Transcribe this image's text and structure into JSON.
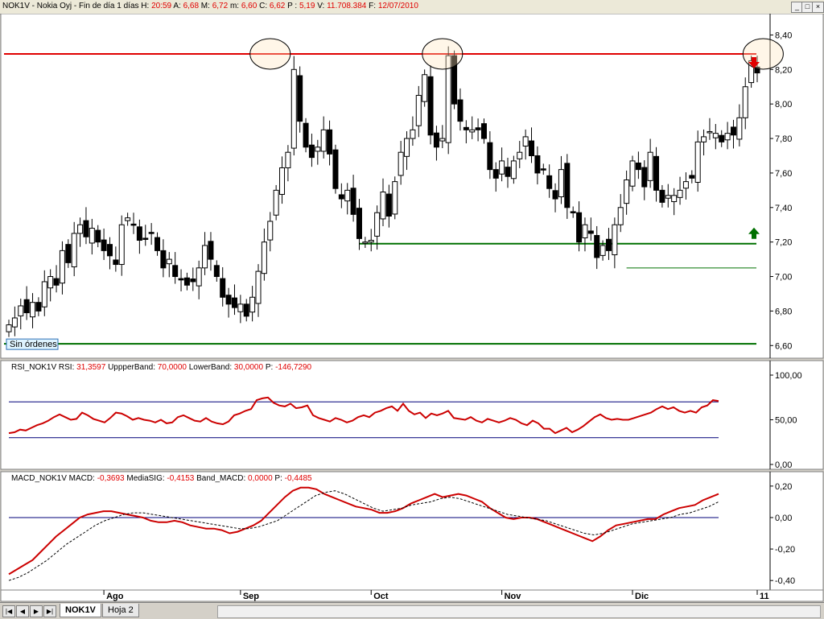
{
  "window": {
    "title": "NOK1V - Nokia Oyj - Fin de día 1 días ",
    "minimize": "_",
    "maximize": "□",
    "close": "×"
  },
  "quote_header": [
    {
      "label": "H: ",
      "value": "20:59"
    },
    {
      "label": "  A: ",
      "value": "6,68"
    },
    {
      "label": "  M: ",
      "value": "6,72"
    },
    {
      "label": "  m: ",
      "value": "6,60"
    },
    {
      "label": "  C: ",
      "value": "6,62"
    },
    {
      "label": "  P : ",
      "value": "5,19"
    },
    {
      "label": "  V: ",
      "value": "11.708.384"
    },
    {
      "label": "  F: ",
      "value": "12/07/2010"
    }
  ],
  "colors": {
    "resistance": "#e00000",
    "support": "#007000",
    "header_value": "#e00000",
    "rsi_line": "#cc0000",
    "macd_line": "#cc0000",
    "band_line": "#00007a",
    "grid_border": "#808080"
  },
  "price_panel": {
    "order_badge": "Sin órdenes",
    "resistance_level": 8.29,
    "support_level": 7.19,
    "support_level_2": 7.05,
    "lower_support_level": 6.61,
    "down_arrow_icon": "arrow-down",
    "up_arrow_icon": "arrow-up"
  },
  "rsi_panel": {
    "header_items": [
      {
        "label": "RSI_NOK1V  RSI: ",
        "value": "31,3597"
      },
      {
        "label": "  UppperBand: ",
        "value": "70,0000"
      },
      {
        "label": "  LowerBand: ",
        "value": "30,0000"
      },
      {
        "label": "  P: ",
        "value": "-146,7290"
      }
    ]
  },
  "macd_panel": {
    "header_items": [
      {
        "label": "MACD_NOK1V  MACD: ",
        "value": "-0,3693"
      },
      {
        "label": "  MediaSIG: ",
        "value": "-0,4153"
      },
      {
        "label": "  Band_MACD: ",
        "value": "0,0000"
      },
      {
        "label": "  P: ",
        "value": "-0,4485"
      }
    ]
  },
  "chart_data": [
    {
      "type": "candlestick",
      "name": "NOK1V",
      "ylim": [
        6.55,
        8.5
      ],
      "y_ticks": [
        "8,40",
        "8,20",
        "8,00",
        "7,80",
        "7,60",
        "7,40",
        "7,20",
        "7,00",
        "6,80",
        "6,60"
      ],
      "y_tick_values": [
        8.4,
        8.2,
        8.0,
        7.8,
        7.6,
        7.4,
        7.2,
        7.0,
        6.8,
        6.6
      ],
      "x_labels": [
        {
          "label": "Ago",
          "index": 16
        },
        {
          "label": "Sep",
          "index": 39
        },
        {
          "label": "Oct",
          "index": 61
        },
        {
          "label": "Nov",
          "index": 83
        },
        {
          "label": "Dic",
          "index": 105
        },
        {
          "label": "11",
          "index": 126
        }
      ],
      "horizontal_lines": [
        {
          "name": "resistance",
          "value": 8.29
        },
        {
          "name": "support",
          "value": 7.19
        },
        {
          "name": "support-2",
          "value": 7.05
        },
        {
          "name": "lower-support",
          "value": 6.61
        }
      ],
      "highlight_indices": [
        44,
        73,
        127
      ],
      "close": [
        6.72,
        6.76,
        6.83,
        6.79,
        6.85,
        6.8,
        6.97,
        7.0,
        6.95,
        7.15,
        7.08,
        7.25,
        7.3,
        7.23,
        7.28,
        7.2,
        7.15,
        7.12,
        7.07,
        7.3,
        7.34,
        7.3,
        7.21,
        7.22,
        7.25,
        7.15,
        7.05,
        7.1,
        7.0,
        6.98,
        6.95,
        6.97,
        7.05,
        7.18,
        7.1,
        7.0,
        6.88,
        6.84,
        6.82,
        6.84,
        6.77,
        6.88,
        7.03,
        7.2,
        7.32,
        7.5,
        7.63,
        7.72,
        8.2,
        7.9,
        7.75,
        7.69,
        7.75,
        7.85,
        7.71,
        7.51,
        7.45,
        7.5,
        7.36,
        7.22,
        7.2,
        7.21,
        7.37,
        7.49,
        7.35,
        7.55,
        7.72,
        7.8,
        7.85,
        8.05,
        8.17,
        7.82,
        7.75,
        7.8,
        8.28,
        8.0,
        7.9,
        7.85,
        7.85,
        7.85,
        7.8,
        7.62,
        7.57,
        7.67,
        7.58,
        7.67,
        7.72,
        7.81,
        7.7,
        7.6,
        7.62,
        7.51,
        7.45,
        7.62,
        7.4,
        7.37,
        7.2,
        7.3,
        7.25,
        7.11,
        7.18,
        7.15,
        7.3,
        7.4,
        7.56,
        7.67,
        7.62,
        7.52,
        7.72,
        7.5,
        7.43,
        7.47,
        7.47,
        7.5,
        7.55,
        7.57,
        7.78,
        7.81,
        7.84,
        7.83,
        7.78,
        7.83,
        7.82,
        7.92,
        8.1,
        8.25,
        8.18
      ]
    },
    {
      "type": "line",
      "name": "RSI_NOK1V",
      "ylim": [
        0,
        100
      ],
      "y_ticks": [
        "100,00",
        "50,00",
        "0,00"
      ],
      "y_tick_values": [
        100,
        50,
        0
      ],
      "bands": [
        {
          "name": "upper-band",
          "value": 70
        },
        {
          "name": "lower-band",
          "value": 30
        }
      ],
      "series": [
        {
          "name": "RSI",
          "values": [
            35,
            36,
            39,
            38,
            41,
            44,
            46,
            49,
            53,
            56,
            53,
            50,
            51,
            58,
            55,
            51,
            49,
            47,
            52,
            58,
            57,
            54,
            50,
            52,
            50,
            49,
            47,
            50,
            46,
            47,
            53,
            55,
            52,
            49,
            48,
            52,
            48,
            46,
            45,
            48,
            55,
            57,
            60,
            62,
            72,
            74,
            75,
            69,
            66,
            65,
            68,
            63,
            64,
            66,
            55,
            52,
            50,
            48,
            52,
            50,
            47,
            49,
            53,
            55,
            53,
            58,
            60,
            63,
            65,
            60,
            68,
            60,
            56,
            58,
            52,
            57,
            55,
            57,
            60,
            52,
            51,
            50,
            53,
            49,
            47,
            51,
            49,
            47,
            49,
            52,
            50,
            46,
            44,
            49,
            46,
            40,
            40,
            35,
            38,
            41,
            36,
            39,
            43,
            48,
            53,
            56,
            52,
            50,
            51,
            50,
            50,
            52,
            54,
            56,
            58,
            62,
            65,
            62,
            64,
            60,
            58,
            60,
            58,
            64,
            66,
            72,
            71
          ]
        }
      ]
    },
    {
      "type": "line",
      "name": "MACD_NOK1V",
      "ylim": [
        -0.44,
        0.23
      ],
      "y_ticks": [
        "0,20",
        "0,00",
        "-0,20",
        "-0,40"
      ],
      "y_tick_values": [
        0.2,
        0.0,
        -0.2,
        -0.4
      ],
      "zero_line": 0.0,
      "series": [
        {
          "name": "MACD",
          "values": [
            -0.36,
            -0.33,
            -0.3,
            -0.27,
            -0.22,
            -0.17,
            -0.12,
            -0.08,
            -0.04,
            0.0,
            0.02,
            0.03,
            0.04,
            0.04,
            0.03,
            0.02,
            0.01,
            0.0,
            -0.02,
            -0.03,
            -0.03,
            -0.02,
            -0.03,
            -0.05,
            -0.06,
            -0.07,
            -0.07,
            -0.08,
            -0.1,
            -0.09,
            -0.07,
            -0.05,
            -0.02,
            0.03,
            0.08,
            0.13,
            0.17,
            0.19,
            0.19,
            0.18,
            0.15,
            0.13,
            0.11,
            0.09,
            0.07,
            0.06,
            0.05,
            0.03,
            0.03,
            0.04,
            0.06,
            0.09,
            0.11,
            0.13,
            0.15,
            0.13,
            0.14,
            0.15,
            0.14,
            0.12,
            0.1,
            0.06,
            0.03,
            0.0,
            -0.01,
            0.0,
            0.0,
            -0.01,
            -0.03,
            -0.05,
            -0.07,
            -0.09,
            -0.11,
            -0.13,
            -0.15,
            -0.12,
            -0.08,
            -0.05,
            -0.04,
            -0.03,
            -0.02,
            -0.01,
            -0.01,
            0.02,
            0.04,
            0.06,
            0.07,
            0.08,
            0.11,
            0.13,
            0.15
          ]
        },
        {
          "name": "MediaSIG",
          "values": [
            -0.4,
            -0.38,
            -0.35,
            -0.31,
            -0.27,
            -0.22,
            -0.17,
            -0.13,
            -0.09,
            -0.05,
            -0.02,
            0.0,
            0.02,
            0.03,
            0.03,
            0.02,
            0.01,
            0.0,
            -0.01,
            -0.02,
            -0.03,
            -0.04,
            -0.05,
            -0.06,
            -0.07,
            -0.07,
            -0.06,
            -0.04,
            -0.02,
            0.02,
            0.06,
            0.1,
            0.14,
            0.16,
            0.17,
            0.15,
            0.12,
            0.09,
            0.06,
            0.04,
            0.05,
            0.06,
            0.08,
            0.09,
            0.1,
            0.12,
            0.13,
            0.12,
            0.1,
            0.08,
            0.06,
            0.04,
            0.02,
            0.01,
            0.0,
            -0.01,
            -0.02,
            -0.04,
            -0.06,
            -0.08,
            -0.1,
            -0.11,
            -0.1,
            -0.08,
            -0.06,
            -0.04,
            -0.03,
            -0.02,
            -0.01,
            0.0,
            0.02,
            0.03,
            0.05,
            0.07,
            0.1
          ]
        }
      ]
    }
  ],
  "x_axis_labels": [
    "Ago",
    "Sep",
    "Oct",
    "Nov",
    "Dic",
    "11"
  ],
  "tabs": {
    "nav_first": "|◀",
    "nav_prev": "◀",
    "nav_next": "▶",
    "nav_last": "▶|",
    "sheets": [
      "NOK1V",
      "Hoja 2"
    ]
  }
}
